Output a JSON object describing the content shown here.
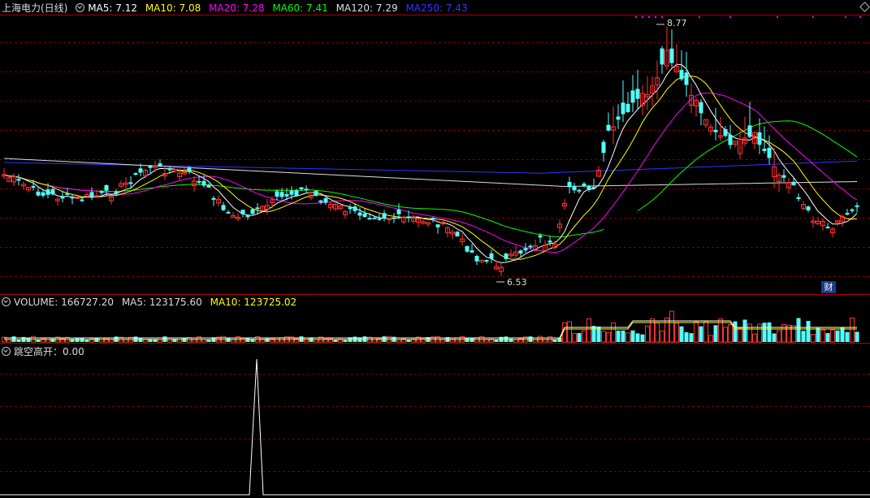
{
  "main_header": {
    "title": "上海电力(日线)",
    "ma5": "MA5: 7.12",
    "ma10": "MA10: 7.08",
    "ma20": "MA20: 7.28",
    "ma60": "MA60: 7.41",
    "ma120": "MA120: 7.29",
    "ma250": "MA250: 7.43"
  },
  "volume_header": {
    "title": "VOLUME: 166727.20",
    "ma5": "MA5: 123175.60",
    "ma10": "MA10: 123725.02"
  },
  "indicator_header": {
    "title": "跳空高开：0.00"
  },
  "high_label": "8.77",
  "low_label": "6.53",
  "finance_button": "财",
  "colors": {
    "up": "#ff3232",
    "down": "#54ffff",
    "ma5": "#ffffff",
    "ma10": "#ffff00",
    "ma20": "#ff00ff",
    "ma60": "#00ff00",
    "ma120": "#dddddd",
    "ma250": "#3333ff",
    "grid": "#7a0000"
  },
  "chart_data": {
    "type": "candlestick",
    "title": "上海电力(日线)",
    "highest": 8.77,
    "lowest": 6.53,
    "moving_averages": [
      {
        "name": "MA5",
        "value": 7.12
      },
      {
        "name": "MA10",
        "value": 7.08
      },
      {
        "name": "MA20",
        "value": 7.28
      },
      {
        "name": "MA60",
        "value": 7.41
      },
      {
        "name": "MA120",
        "value": 7.29
      },
      {
        "name": "MA250",
        "value": 7.43
      }
    ],
    "volume": 166727.2,
    "volume_ma5": 123175.6,
    "volume_ma10": 123725.02,
    "indicator": {
      "name": "跳空高开",
      "value": 0.0
    }
  }
}
